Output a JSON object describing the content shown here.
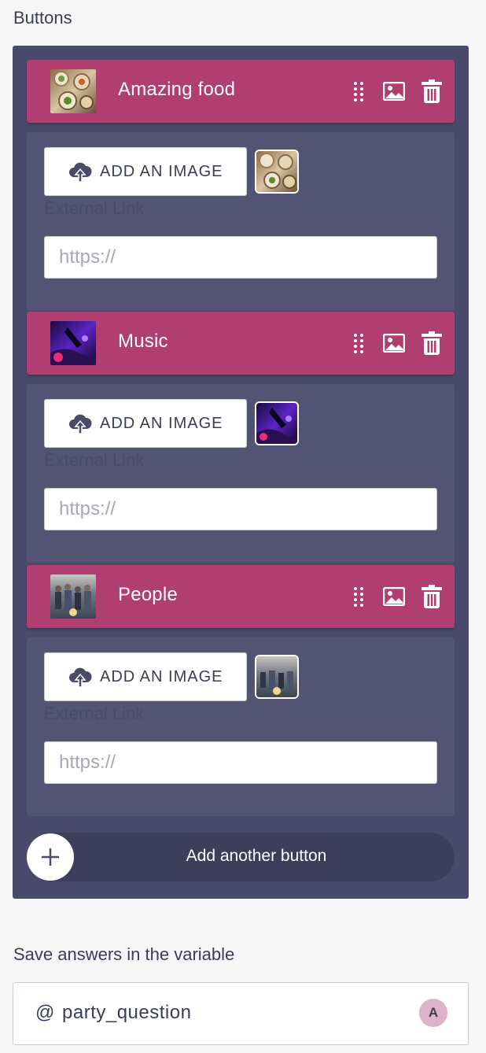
{
  "section_title": "Buttons",
  "buttons": [
    {
      "label": "Amazing food",
      "thumbnail": "food-photo",
      "add_image_label": "ADD AN IMAGE",
      "external_link_label": "External Link",
      "url_placeholder": "https://",
      "url_value": ""
    },
    {
      "label": "Music",
      "thumbnail": "music-photo",
      "add_image_label": "ADD AN IMAGE",
      "external_link_label": "External Link",
      "url_placeholder": "https://",
      "url_value": ""
    },
    {
      "label": "People",
      "thumbnail": "people-photo",
      "add_image_label": "ADD AN IMAGE",
      "external_link_label": "External Link",
      "url_placeholder": "https://",
      "url_value": ""
    }
  ],
  "add_another_label": "Add another button",
  "save_section_title": "Save answers in the variable",
  "variable": {
    "prefix": "@",
    "name": "party_question",
    "badge": "A"
  },
  "colors": {
    "panel": "#494a6c",
    "button_header": "#b13e70",
    "button_body": "#535373",
    "add_another_bg": "#3d3e5c",
    "badge": "#dcb1c9"
  },
  "icons": {
    "drag": "drag-handle-icon",
    "image": "image-icon",
    "delete": "trash-icon",
    "upload": "cloud-upload-icon",
    "add": "plus-icon"
  }
}
